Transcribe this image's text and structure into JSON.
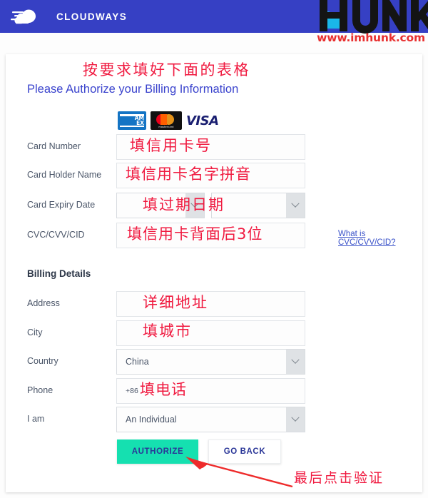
{
  "header": {
    "brand_name": "CLOUDWAYS",
    "brand_icon": "cloud-speed-icon",
    "watermark_word": "HUNK",
    "watermark_url": "www.imhunk.com",
    "bar_color": "#3640c4"
  },
  "annotations": {
    "title": "按要求填好下面的表格",
    "card_number": "填信用卡号",
    "card_holder": "填信用卡名字拼音",
    "card_expiry": "填过期日期",
    "cvc": "填信用卡背面后3位",
    "address": "详细地址",
    "city": "填城市",
    "phone": "填电话",
    "final": "最后点击验证",
    "color": "#f01a40",
    "arrow_color": "#ee2b2b"
  },
  "page": {
    "title": "Please Authorize your Billing Information",
    "title_color": "#3a43cd"
  },
  "card_brands": [
    {
      "name": "amex-logo",
      "label": "AMEX"
    },
    {
      "name": "mastercard-logo",
      "label": "mastercard"
    },
    {
      "name": "visa-logo",
      "label": "VISA"
    }
  ],
  "payment_form": {
    "fields": [
      {
        "label": "Card Number",
        "value": "",
        "type": "text"
      },
      {
        "label": "Card Holder Name",
        "value": "",
        "type": "text"
      },
      {
        "label": "Card Expiry Date",
        "value": "",
        "type": "select-pair"
      },
      {
        "label": "CVC/CVV/CID",
        "value": "",
        "type": "text"
      }
    ],
    "cvc_help_link": "What is CVC/CVV/CID?"
  },
  "billing": {
    "section_title": "Billing Details",
    "fields": [
      {
        "label": "Address",
        "value": "",
        "type": "text"
      },
      {
        "label": "City",
        "value": "",
        "type": "text"
      },
      {
        "label": "Country",
        "value": "China",
        "type": "select"
      },
      {
        "label": "Phone",
        "value": "+86",
        "type": "text"
      },
      {
        "label": "I am",
        "value": "An Individual",
        "type": "select"
      }
    ]
  },
  "actions": {
    "authorize_label": "AUTHORIZE",
    "authorize_color": "#15e0b0",
    "goback_label": "GO BACK",
    "button_text_color": "#2a3698"
  }
}
